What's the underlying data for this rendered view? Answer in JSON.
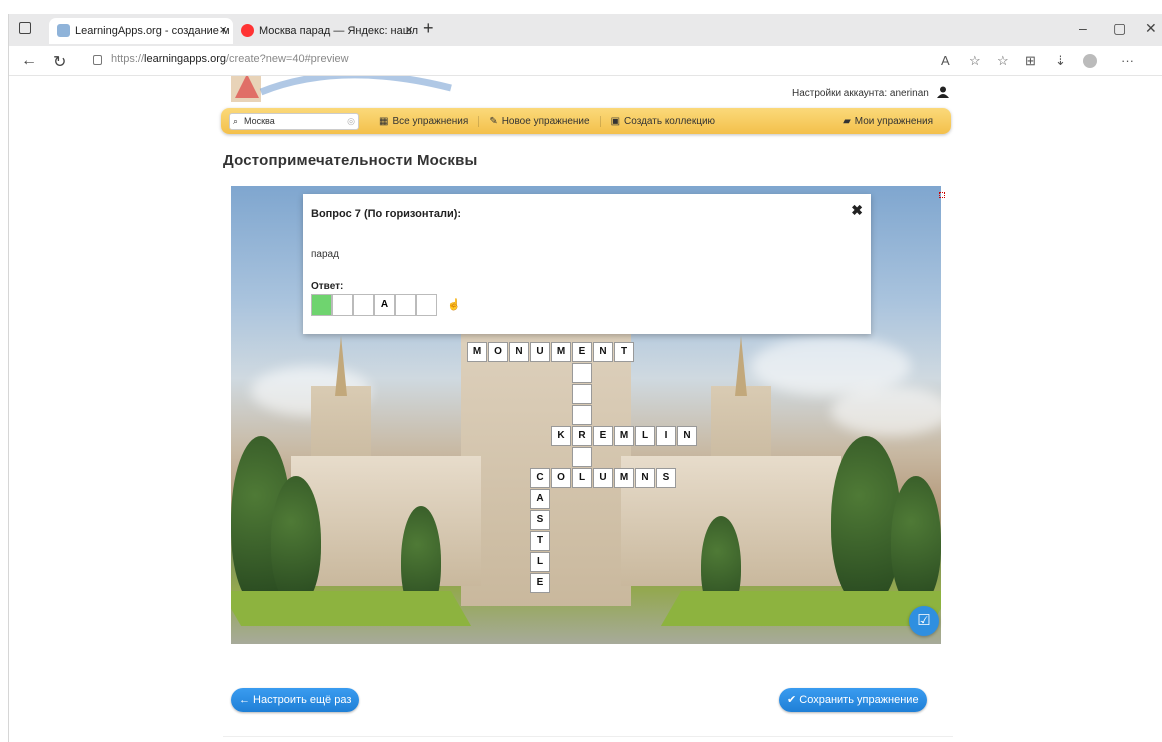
{
  "browser": {
    "tabs": [
      {
        "title": "LearningApps.org - создание м",
        "active": true
      },
      {
        "title": "Москва парад — Яндекс: нашл",
        "active": false
      }
    ],
    "new_tab": "+",
    "window_controls": [
      "–",
      "▢",
      "✕"
    ],
    "url_prefix": "https://",
    "url_host": "learningapps.org",
    "url_path": "/create?new=40#preview",
    "reader_label": "A"
  },
  "site": {
    "account_label": "Настройки аккаунта: anerinan",
    "search_value": "Москва",
    "menu": {
      "all_exercises": "Все упражнения",
      "new_exercise": "Новое упражнение",
      "create_collection": "Создать коллекцию",
      "my_exercises": "Мои упражнения"
    },
    "exercise_title": "Достопримечательности Москвы"
  },
  "question_popup": {
    "title": "Вопрос 7 (По горизонтали):",
    "clue": "парад",
    "answer_label": "Ответ:",
    "answer_cells": [
      "",
      "",
      "",
      "A",
      "",
      ""
    ],
    "close": "✖"
  },
  "crossword": {
    "words": [
      {
        "word": "MONUMENT",
        "dir": "across",
        "num": ""
      },
      {
        "word": "KREMLIN",
        "dir": "across",
        "num": ""
      },
      {
        "word": "COLUMNS",
        "dir": "across",
        "num": ""
      },
      {
        "word": "CASTLE",
        "dir": "down",
        "num": ""
      }
    ]
  },
  "buttons": {
    "reset": "← Настроить ещё раз",
    "save": "✔ Сохранить упражнение"
  },
  "colors": {
    "menu_bg": "#f3c04b",
    "button_blue": "#1f7fd6",
    "answer_green": "#6fd46f"
  }
}
